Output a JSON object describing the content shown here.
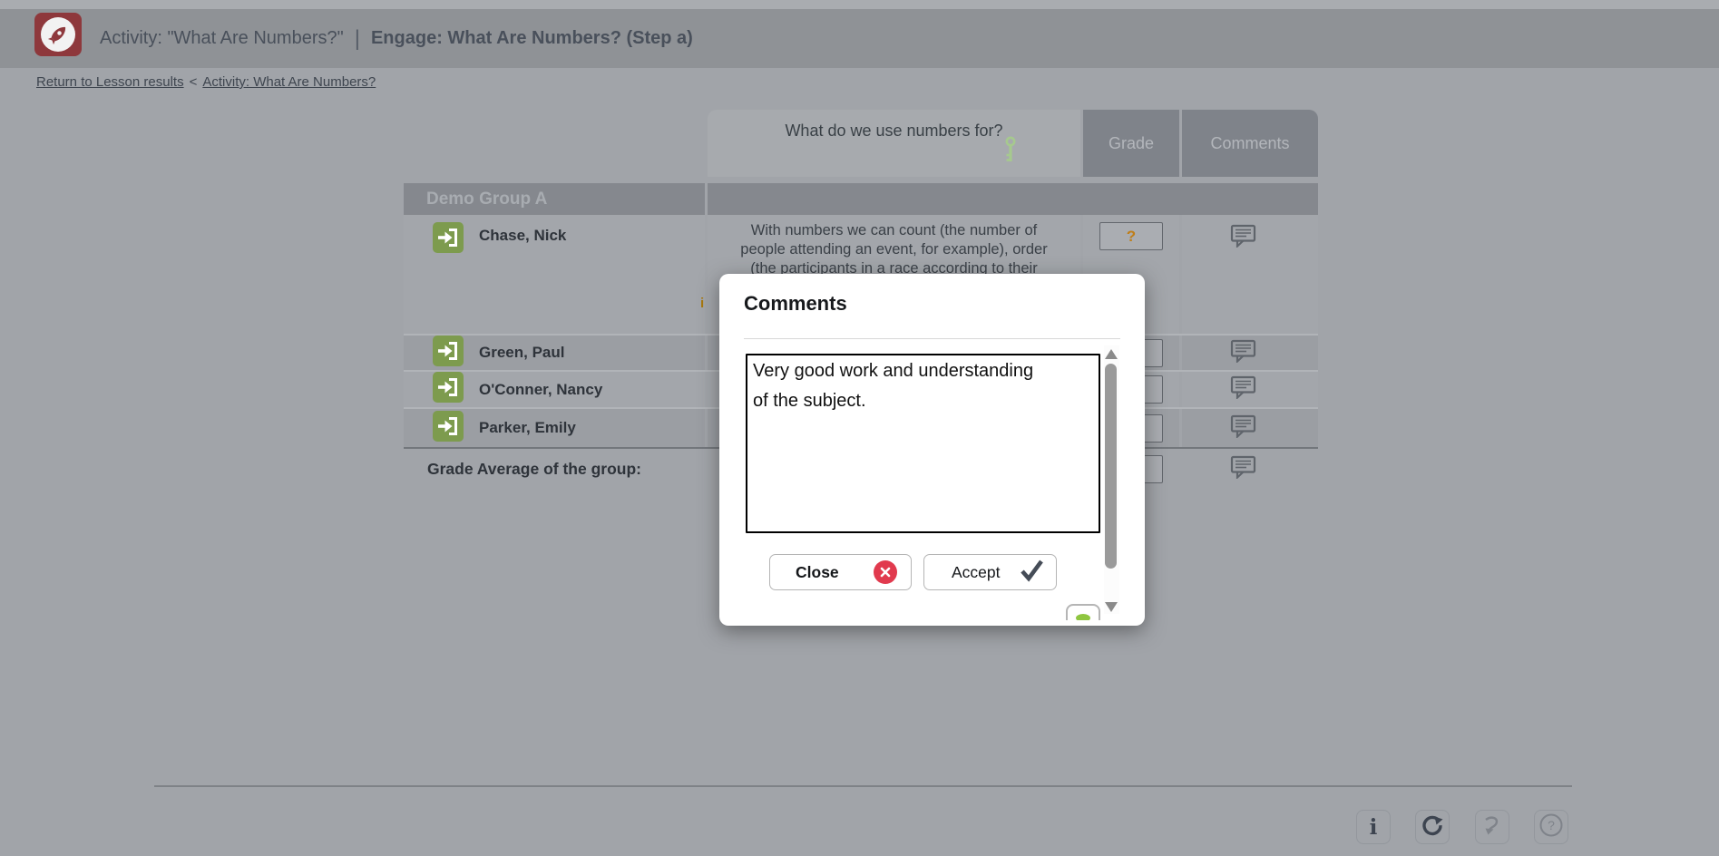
{
  "header": {
    "title_activity": "Activity: \"What Are Numbers?\"",
    "title_separator": "|",
    "title_step": "Engage: What Are Numbers? (Step a)"
  },
  "breadcrumb": {
    "return_link": "Return to Lesson results",
    "separator": "<",
    "activity_link": "Activity: What Are Numbers?"
  },
  "table": {
    "question_header": "What do we use numbers for?",
    "grade_header": "Grade",
    "comments_header": "Comments",
    "group_name": "Demo Group A",
    "rows": [
      {
        "name": "Chase, Nick",
        "answer_lines": [
          "With numbers we can count (the number of",
          "people attending an event, for example), order",
          "(the participants in a race according to their"
        ],
        "grade": "?"
      },
      {
        "name": "Green, Paul",
        "grade": ""
      },
      {
        "name": "O'Conner, Nancy",
        "grade": ""
      },
      {
        "name": "Parker, Emily",
        "grade": ""
      }
    ],
    "average_label": "Grade Average of the group:",
    "obscured_fragment": "i"
  },
  "modal": {
    "title": "Comments",
    "comment_text": "Very good work and understanding\nof the subject.",
    "close_label": "Close",
    "accept_label": "Accept"
  },
  "colors": {
    "page_bg": "#a1a4a9",
    "header_bar": "#8f9296",
    "logo_red": "#8e383c",
    "accent_green": "#7d9b4e",
    "key_green": "#a6c98e",
    "grade_question_orange": "#bf7e19",
    "close_red": "#e13a4e",
    "check_dark": "#454c57"
  }
}
